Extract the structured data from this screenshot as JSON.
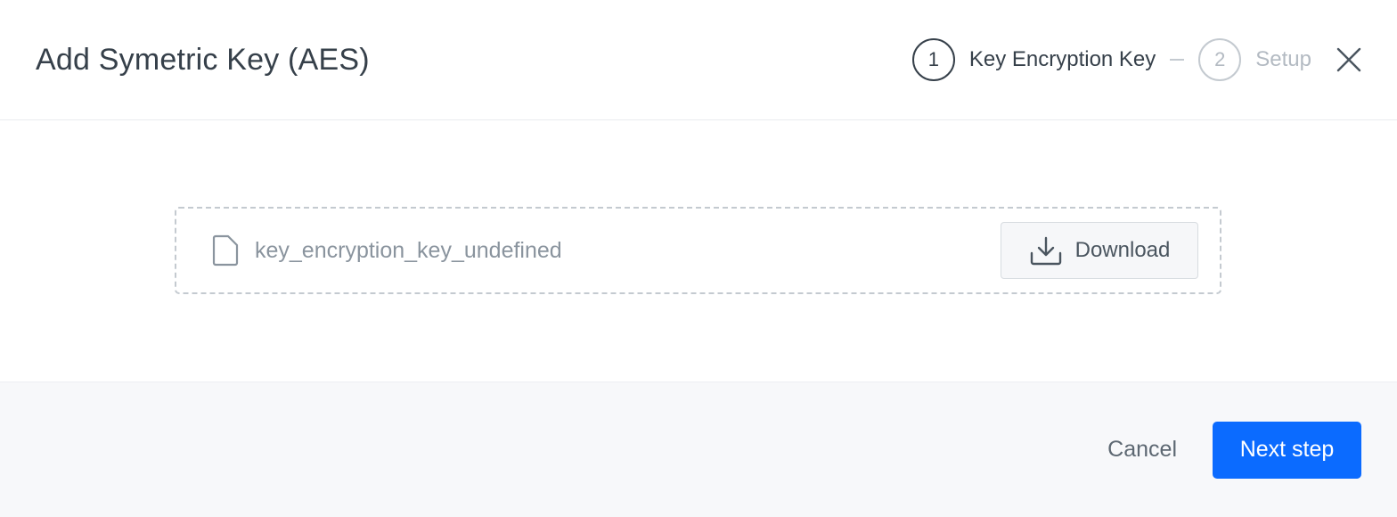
{
  "header": {
    "title": "Add Symetric Key (AES)"
  },
  "stepper": {
    "steps": [
      {
        "number": "1",
        "label": "Key Encryption Key"
      },
      {
        "number": "2",
        "label": "Setup"
      }
    ],
    "separator": "–"
  },
  "file": {
    "name": "key_encryption_key_undefined",
    "icon": "file-icon",
    "download_label": "Download",
    "download_icon": "download-icon"
  },
  "footer": {
    "cancel_label": "Cancel",
    "next_label": "Next step"
  },
  "colors": {
    "primary": "#0b6bff",
    "text": "#36404a",
    "muted": "#b3bac2"
  }
}
